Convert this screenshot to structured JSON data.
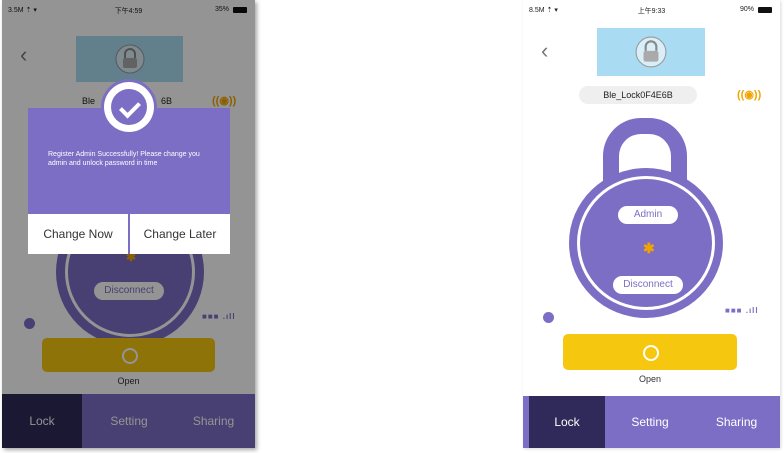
{
  "status_left": {
    "carrier": "3.5M ⇡ ▾",
    "time": "下午4:59",
    "battery": "35%"
  },
  "status_right": {
    "carrier": "8.5M ⇡ ▾",
    "time": "上午9:33",
    "battery": "90%"
  },
  "lock_name": "Ble_Lock0F4E6B",
  "left_lock_name_partial": "Ble",
  "left_lock_name_tail": "6B",
  "lock_screen": {
    "admin_label": "Admin",
    "disconnect_label": "Disconnect",
    "open_label": "Open",
    "bluetooth_symbol": "✱",
    "alarm_symbol": "((◉))",
    "signal_text": "■■■ .ıll"
  },
  "tabs": {
    "lock": "Lock",
    "setting": "Setting",
    "sharing": "Sharing"
  },
  "dialog": {
    "message": "Register Admin Successfully! Please change you admin and unlock password in time",
    "change_now": "Change Now",
    "change_later": "Change Later"
  },
  "colors": {
    "accent": "#7c6ec4",
    "yellow": "#f5c70e",
    "orange": "#f1a400",
    "tab_active": "#2f2a5a"
  },
  "icons": [
    "back-icon",
    "padlock-icon",
    "alarm-icon",
    "bluetooth-icon",
    "check-icon",
    "unlock-circle-icon"
  ]
}
